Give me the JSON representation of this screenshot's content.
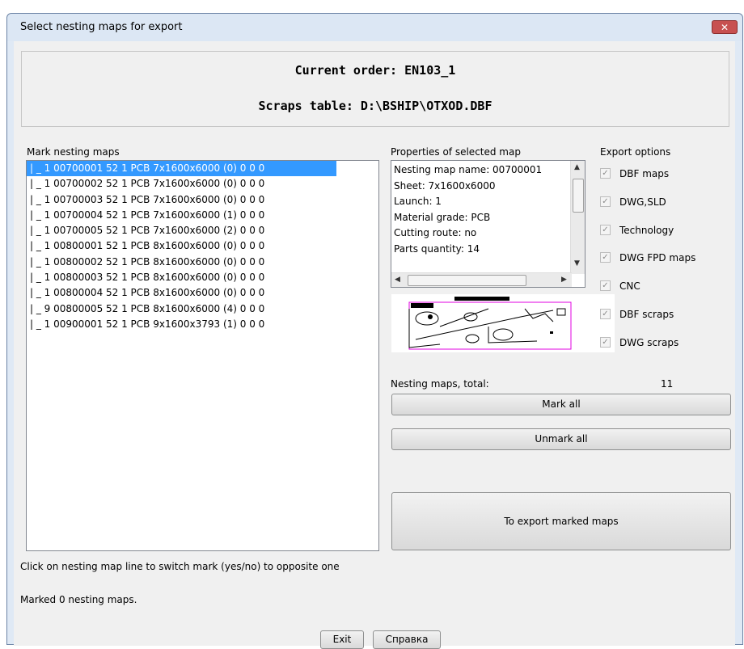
{
  "window": {
    "title": "Select nesting maps for export",
    "close_glyph": "✕"
  },
  "header": {
    "current_order": "Current order: EN103_1",
    "scraps_table": "Scraps table: D:\\BSHIP\\OTXOD.DBF"
  },
  "list": {
    "label": "Mark nesting maps",
    "items": [
      "| _ 1 00700001 52 1 PCB 7x1600x6000 (0) 0 0 0",
      "| _ 1 00700002 52 1 PCB 7x1600x6000 (0) 0 0 0",
      "| _ 1 00700003 52 1 PCB 7x1600x6000 (0) 0 0 0",
      "| _ 1 00700004 52 1 PCB 7x1600x6000 (1) 0 0 0",
      "| _ 1 00700005 52 1 PCB 7x1600x6000 (2) 0 0 0",
      "| _ 1 00800001 52 1 PCB 8x1600x6000 (0) 0 0 0",
      "| _ 1 00800002 52 1 PCB 8x1600x6000 (0) 0 0 0",
      "| _ 1 00800003 52 1 PCB 8x1600x6000 (0) 0 0 0",
      "| _ 1 00800004 52 1 PCB 8x1600x6000 (0) 0 0 0",
      "| _ 9 00800005 52 1 PCB 8x1600x6000 (4) 0 0 0",
      "| _ 1 00900001 52 1 PCB 9x1600x3793 (1) 0 0 0"
    ],
    "hint": "Click on nesting map line to switch mark (yes/no) to opposite one",
    "status": "Marked 0 nesting maps."
  },
  "properties": {
    "label": "Properties of selected map",
    "rows": [
      "Nesting map name: 00700001",
      "Sheet: 7x1600x6000",
      "Launch: 1",
      "Material grade: PCB",
      "Cutting route: no",
      "Parts quantity: 14"
    ]
  },
  "export_options": {
    "label": "Export options",
    "items": [
      "DBF maps",
      "DWG,SLD",
      "Technology",
      "DWG FPD maps",
      "CNC",
      "DBF scraps",
      "DWG scraps"
    ]
  },
  "totals": {
    "label": "Nesting maps, total:",
    "value": "11"
  },
  "buttons": {
    "mark_all": "Mark all",
    "unmark_all": "Unmark all",
    "export": "To export marked maps",
    "exit": "Exit",
    "help": "Справка"
  },
  "colors": {
    "selection": "#3399ff",
    "preview_outline": "#e000e0",
    "close_button": "#c75050"
  }
}
